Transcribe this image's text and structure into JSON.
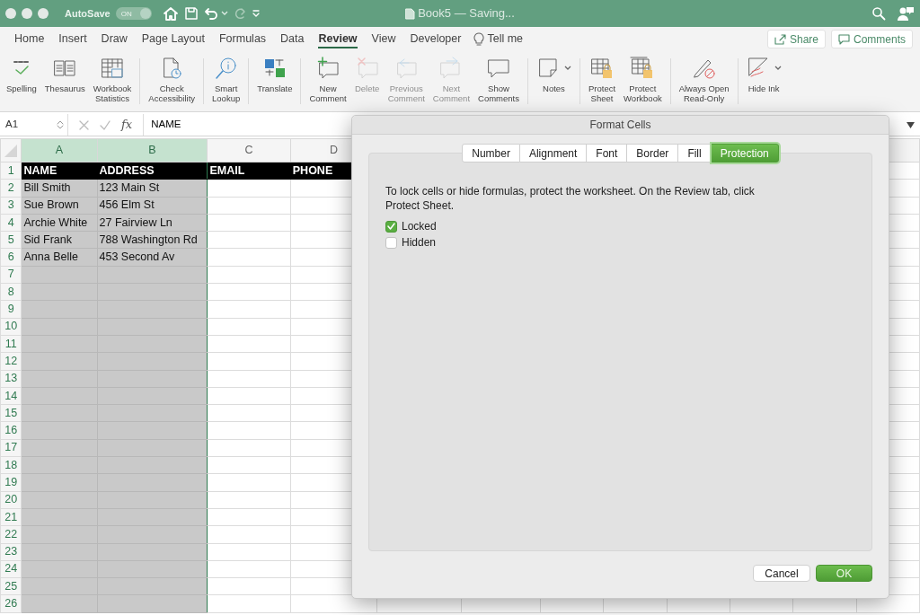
{
  "title_bar": {
    "autosave_label": "AutoSave",
    "autosave_toggle": {
      "label": "ON",
      "on": true
    },
    "document_title": "Book5 — Saving..."
  },
  "ribbon_tabs": [
    {
      "label": "Home",
      "selected": false
    },
    {
      "label": "Insert",
      "selected": false
    },
    {
      "label": "Draw",
      "selected": false
    },
    {
      "label": "Page Layout",
      "selected": false
    },
    {
      "label": "Formulas",
      "selected": false
    },
    {
      "label": "Data",
      "selected": false
    },
    {
      "label": "Review",
      "selected": true
    },
    {
      "label": "View",
      "selected": false
    },
    {
      "label": "Developer",
      "selected": false
    }
  ],
  "tell_me": "Tell me",
  "share_button": "Share",
  "comments_button": "Comments",
  "ribbon_groups": [
    [
      {
        "lines": [
          "Spelling"
        ],
        "disabled": false
      },
      {
        "lines": [
          "Thesaurus"
        ],
        "disabled": false
      },
      {
        "lines": [
          "Workbook",
          "Statistics"
        ],
        "disabled": false
      }
    ],
    [
      {
        "lines": [
          "Check",
          "Accessibility"
        ],
        "disabled": false
      }
    ],
    [
      {
        "lines": [
          "Smart",
          "Lookup"
        ],
        "disabled": false
      }
    ],
    [
      {
        "lines": [
          "Translate"
        ],
        "disabled": false
      }
    ],
    [
      {
        "lines": [
          "New",
          "Comment"
        ],
        "disabled": false
      },
      {
        "lines": [
          "Delete"
        ],
        "disabled": true
      },
      {
        "lines": [
          "Previous",
          "Comment"
        ],
        "disabled": true
      },
      {
        "lines": [
          "Next",
          "Comment"
        ],
        "disabled": true
      },
      {
        "lines": [
          "Show",
          "Comments"
        ],
        "disabled": false
      }
    ],
    [
      {
        "lines": [
          "Notes"
        ],
        "disabled": false
      }
    ],
    [
      {
        "lines": [
          "Protect",
          "Sheet"
        ],
        "disabled": false
      },
      {
        "lines": [
          "Protect",
          "Workbook"
        ],
        "disabled": false
      }
    ],
    [
      {
        "lines": [
          "Always Open",
          "Read-Only"
        ],
        "disabled": false
      }
    ],
    [
      {
        "lines": [
          "Hide Ink"
        ],
        "disabled": false
      }
    ]
  ],
  "formula_bar": {
    "name_box": "A1",
    "function_label": "fx",
    "formula": "NAME"
  },
  "sheet": {
    "columns": [
      {
        "label": "A",
        "selected": true
      },
      {
        "label": "B",
        "selected": true
      },
      {
        "label": "C",
        "selected": false
      },
      {
        "label": "D",
        "selected": false
      }
    ],
    "rows": [
      {
        "number": "1",
        "header": true,
        "cells": [
          "NAME",
          "ADDRESS",
          "EMAIL",
          "PHONE"
        ]
      },
      {
        "number": "2",
        "header": false,
        "cells": [
          "Bill Smith",
          "123 Main St"
        ]
      },
      {
        "number": "3",
        "header": false,
        "cells": [
          "Sue Brown",
          "456 Elm St"
        ]
      },
      {
        "number": "4",
        "header": false,
        "cells": [
          "Archie White",
          "27 Fairview Ln"
        ]
      },
      {
        "number": "5",
        "header": false,
        "cells": [
          "Sid Frank",
          "788 Washington Rd"
        ]
      },
      {
        "number": "6",
        "header": false,
        "cells": [
          "Anna Belle",
          "453 Second Av"
        ]
      },
      {
        "number": "7",
        "header": false,
        "cells": []
      },
      {
        "number": "8",
        "header": false,
        "cells": []
      },
      {
        "number": "9",
        "header": false,
        "cells": []
      },
      {
        "number": "10",
        "header": false,
        "cells": []
      },
      {
        "number": "11",
        "header": false,
        "cells": []
      },
      {
        "number": "12",
        "header": false,
        "cells": []
      },
      {
        "number": "13",
        "header": false,
        "cells": []
      },
      {
        "number": "14",
        "header": false,
        "cells": []
      },
      {
        "number": "15",
        "header": false,
        "cells": []
      },
      {
        "number": "16",
        "header": false,
        "cells": []
      },
      {
        "number": "17",
        "header": false,
        "cells": []
      },
      {
        "number": "18",
        "header": false,
        "cells": []
      },
      {
        "number": "19",
        "header": false,
        "cells": []
      },
      {
        "number": "20",
        "header": false,
        "cells": []
      },
      {
        "number": "21",
        "header": false,
        "cells": []
      },
      {
        "number": "22",
        "header": false,
        "cells": []
      },
      {
        "number": "23",
        "header": false,
        "cells": []
      },
      {
        "number": "24",
        "header": false,
        "cells": []
      },
      {
        "number": "25",
        "header": false,
        "cells": []
      },
      {
        "number": "26",
        "header": false,
        "cells": []
      }
    ]
  },
  "dialog": {
    "title": "Format Cells",
    "tabs": [
      {
        "label": "Number",
        "selected": false
      },
      {
        "label": "Alignment",
        "selected": false
      },
      {
        "label": "Font",
        "selected": false
      },
      {
        "label": "Border",
        "selected": false
      },
      {
        "label": "Fill",
        "selected": false
      },
      {
        "label": "Protection",
        "selected": true
      }
    ],
    "description": "To lock cells or hide formulas, protect the worksheet. On the Review tab, click Protect Sheet.",
    "options": [
      {
        "label": "Locked",
        "checked": true
      },
      {
        "label": "Hidden",
        "checked": false
      }
    ],
    "buttons": [
      {
        "label": "Cancel",
        "kind": "secondary"
      },
      {
        "label": "OK",
        "kind": "primary"
      }
    ]
  }
}
